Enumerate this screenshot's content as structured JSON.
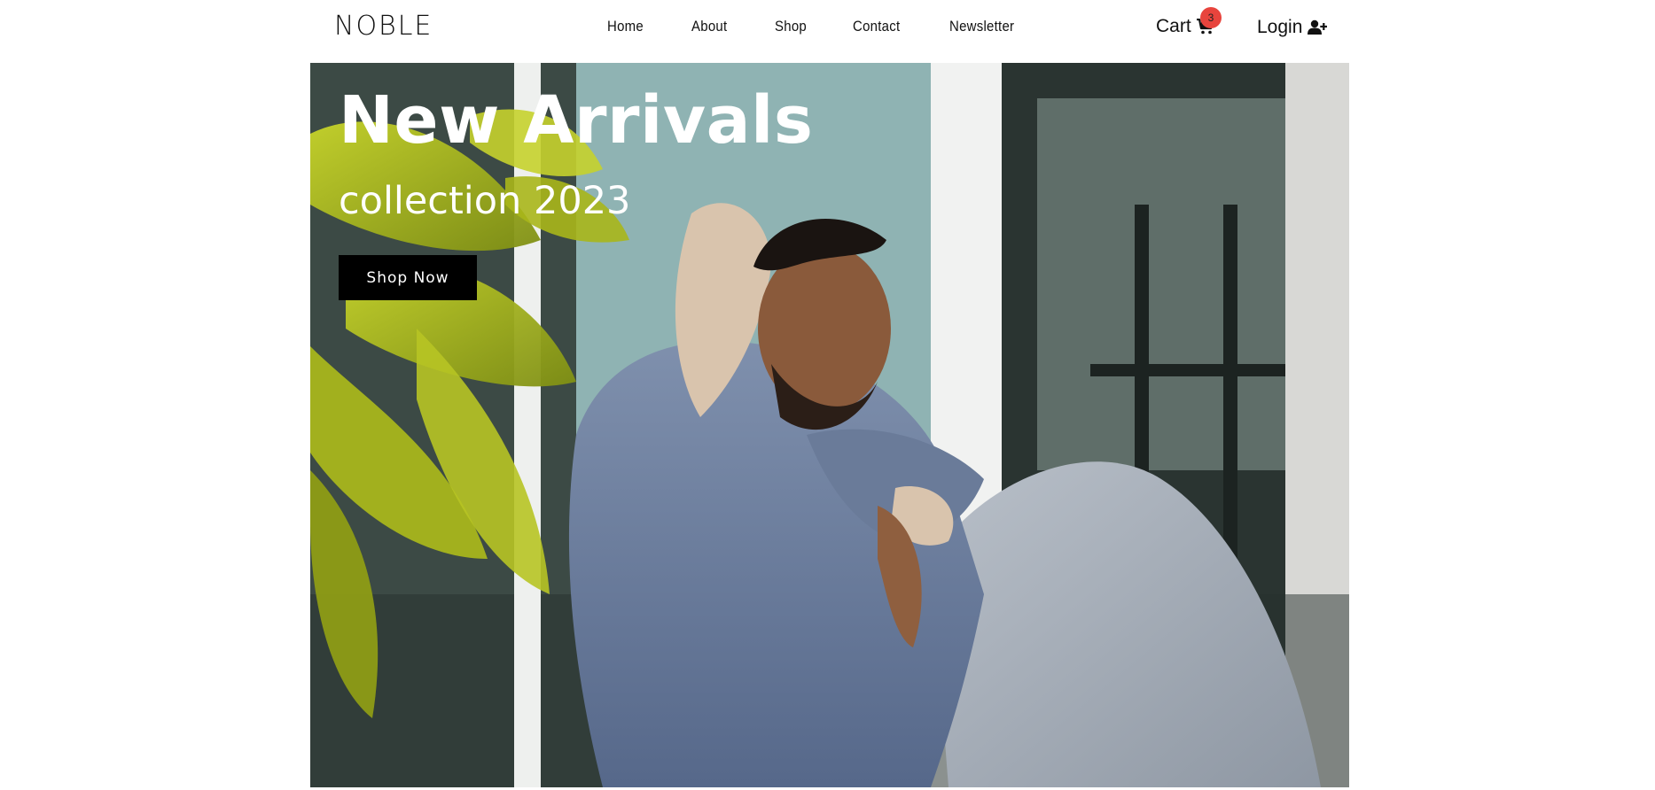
{
  "brand": {
    "logo": "NOBLE"
  },
  "nav": {
    "links": [
      {
        "label": "Home"
      },
      {
        "label": "About"
      },
      {
        "label": "Shop"
      },
      {
        "label": "Contact"
      },
      {
        "label": "Newsletter"
      }
    ]
  },
  "cart": {
    "label": "Cart",
    "count": "3",
    "icon": "cart-icon"
  },
  "account": {
    "label": "Login",
    "icon": "user-plus-icon"
  },
  "hero": {
    "title": "New Arrivals",
    "subtitle": "collection 2023",
    "cta_label": "Shop Now",
    "image": "model-in-denim-jacket-photo"
  },
  "colors": {
    "badge": "#e8443d",
    "button_bg": "#000000",
    "text": "#111111",
    "hero_text": "#ffffff"
  }
}
